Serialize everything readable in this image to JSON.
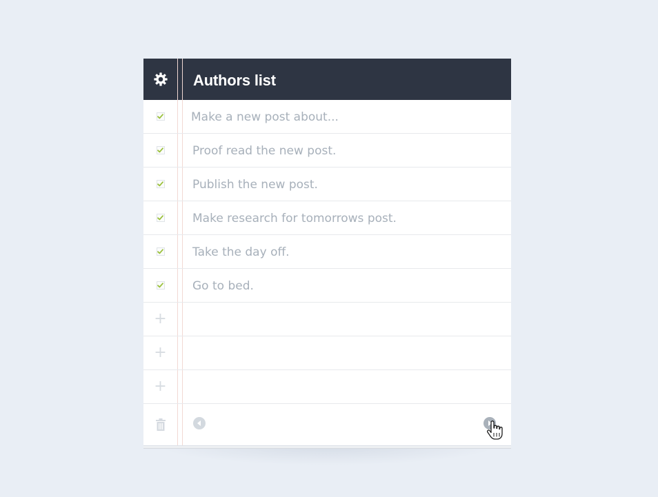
{
  "app": {
    "title": "Authors list"
  },
  "icons": {
    "settings": "gear-icon",
    "check": "check-icon",
    "add": "plus-icon",
    "delete": "trash-icon",
    "previous": "arrow-left-circle-icon",
    "next": "arrow-right-circle-icon",
    "pointer": "hand-cursor-icon"
  },
  "tasks": [
    {
      "label": "Make a new post about...",
      "checked": true
    },
    {
      "label": "Proof read the new post.",
      "checked": true
    },
    {
      "label": "Publish the new post.",
      "checked": true
    },
    {
      "label": "Make research for tomorrows post.",
      "checked": true
    },
    {
      "label": "Take the day off.",
      "checked": true
    },
    {
      "label": "Go to bed.",
      "checked": true
    }
  ],
  "empty_rows": [
    {
      "add_symbol": "+"
    },
    {
      "add_symbol": "+"
    },
    {
      "add_symbol": "+"
    }
  ],
  "colors": {
    "background": "#e9eef5",
    "header": "#2e3543",
    "check": "#9bc13c",
    "text": "#a7b0ba",
    "margin_line": "#f1d8d3"
  }
}
